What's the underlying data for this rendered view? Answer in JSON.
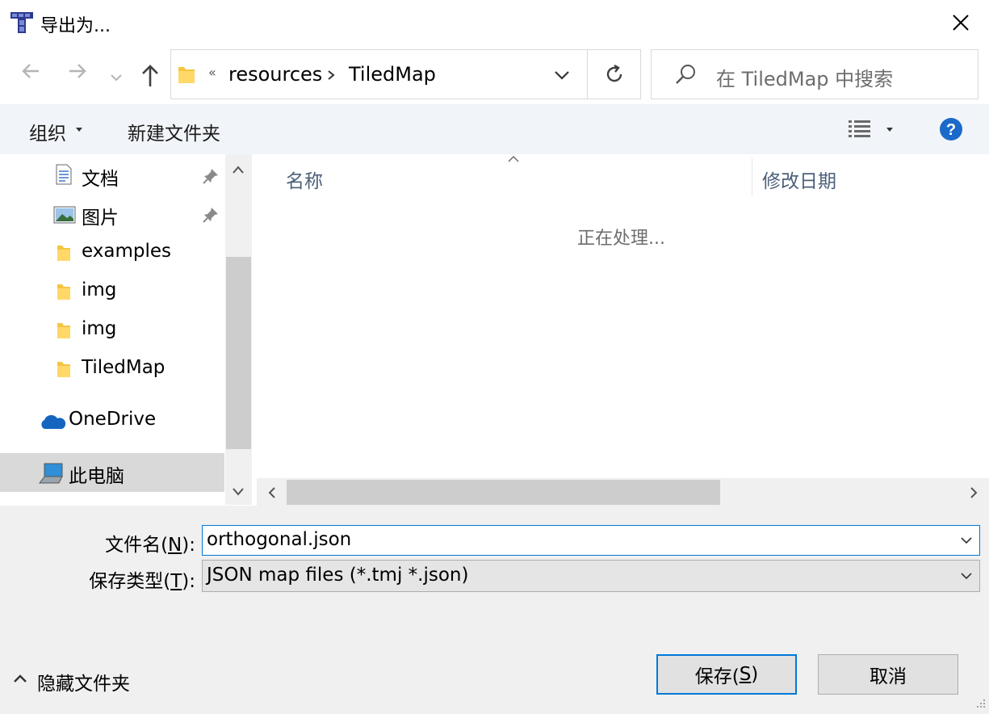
{
  "window": {
    "title": "导出为..."
  },
  "nav": {
    "back_icon": "arrow-left-icon",
    "forward_icon": "arrow-right-icon",
    "up_icon": "arrow-up-icon"
  },
  "address": {
    "overflow": "«",
    "crumbs": [
      "resources",
      "TiledMap"
    ]
  },
  "search": {
    "placeholder": "在 TiledMap 中搜索"
  },
  "toolbar": {
    "organize_label": "组织",
    "new_folder_label": "新建文件夹"
  },
  "sidebar": {
    "items": [
      {
        "label": "文档",
        "icon": "document-icon",
        "pinned": true
      },
      {
        "label": "图片",
        "icon": "pictures-icon",
        "pinned": true
      },
      {
        "label": "examples",
        "icon": "folder-icon"
      },
      {
        "label": "img",
        "icon": "folder-icon"
      },
      {
        "label": "img",
        "icon": "folder-icon"
      },
      {
        "label": "TiledMap",
        "icon": "folder-icon"
      },
      {
        "label": "OneDrive",
        "icon": "onedrive-icon"
      },
      {
        "label": "此电脑",
        "icon": "computer-icon",
        "selected": true
      }
    ]
  },
  "content": {
    "columns": [
      "名称",
      "修改日期"
    ],
    "status": "正在处理..."
  },
  "form": {
    "filename_label_prefix": "文件名(",
    "filename_label_key": "N",
    "filename_label_suffix": "):",
    "filename_value": "orthogonal.json",
    "type_label_prefix": "保存类型(",
    "type_label_key": "T",
    "type_label_suffix": "):",
    "type_value": "JSON map files (*.tmj *.json)"
  },
  "footer": {
    "hide_folders_label": "隐藏文件夹",
    "save_prefix": "保存(",
    "save_key": "S",
    "save_suffix": ")",
    "cancel_label": "取消"
  },
  "colors": {
    "accent": "#0078d7",
    "help": "#1b6ac9"
  }
}
